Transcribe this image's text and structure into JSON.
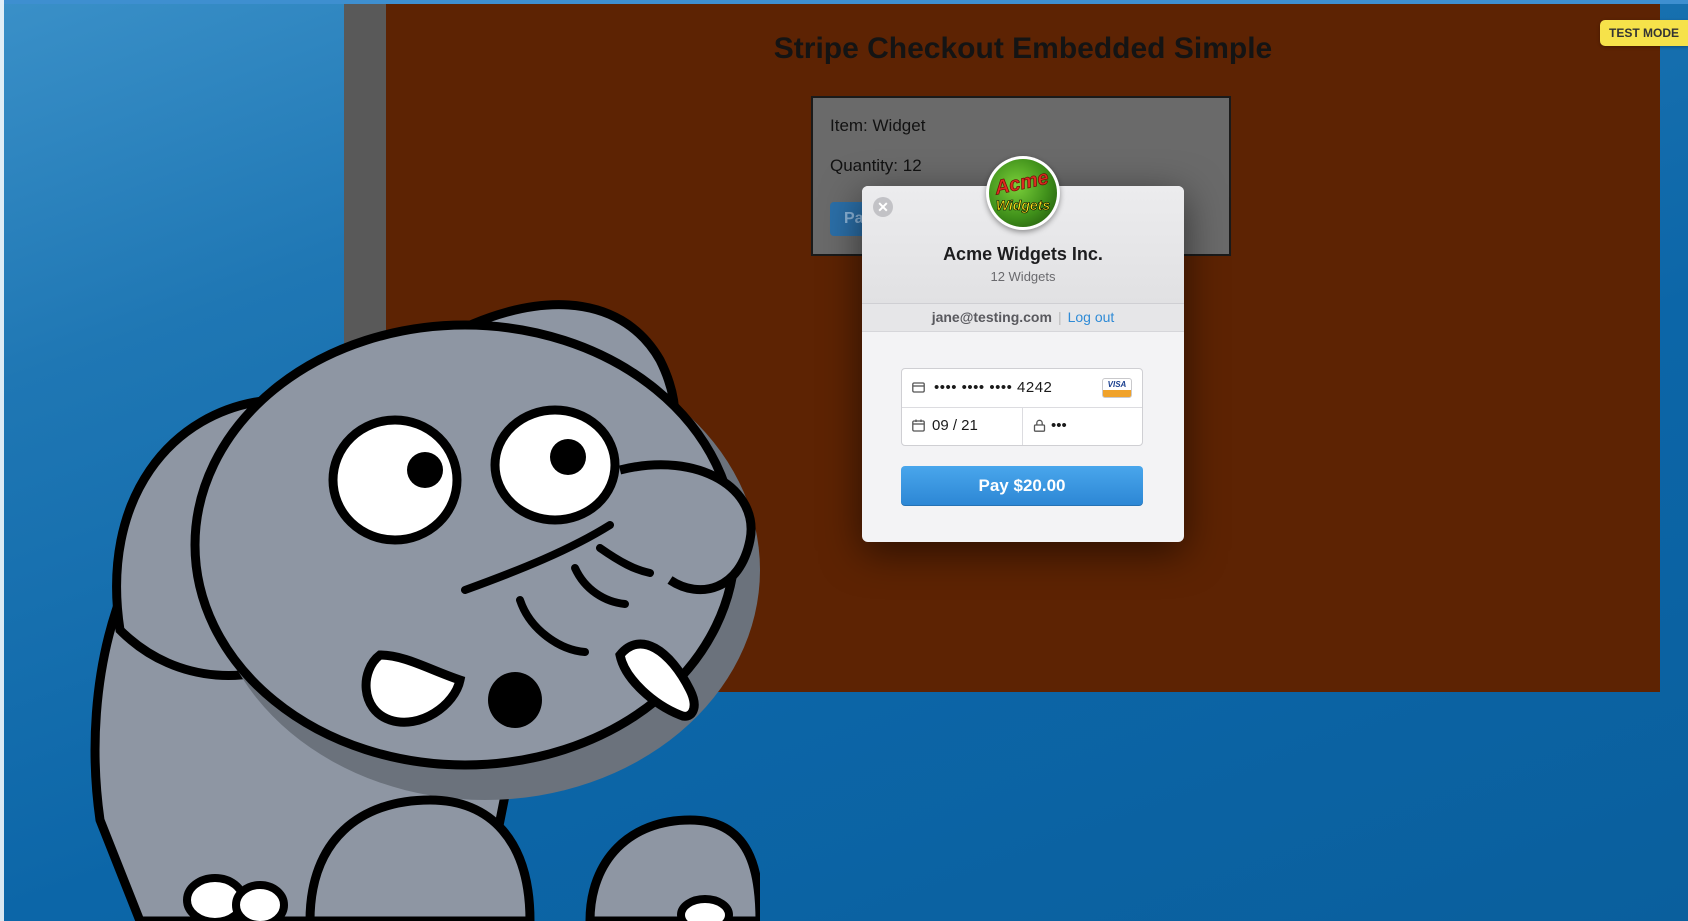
{
  "page": {
    "title": "Stripe Checkout Embedded Simple",
    "order": {
      "item_line": "Item: Widget",
      "quantity_line": "Quantity: 12",
      "pay_label": "Pa"
    }
  },
  "test_mode": {
    "label": "TEST MODE"
  },
  "checkout": {
    "close_icon": "close-icon",
    "logo": {
      "line1": "Acme",
      "line2": "Widgets"
    },
    "merchant_name": "Acme Widgets Inc.",
    "description": "12 Widgets",
    "account": {
      "email": "jane@testing.com",
      "separator": "|",
      "logout_label": "Log out"
    },
    "card": {
      "number": "•••• •••• •••• 4242",
      "brand": "VISA",
      "expiry": "09 / 21",
      "cvc": "•••"
    },
    "pay_button_label": "Pay $20.00"
  },
  "colors": {
    "background": "#1f77b4",
    "page_area": "#5d2303",
    "pay_button": "#2c86d4",
    "test_badge": "#f6e24a",
    "logout_link": "#2f8bd6"
  },
  "icons": [
    "close-icon",
    "card-icon",
    "calendar-icon",
    "lock-icon",
    "visa-icon"
  ]
}
